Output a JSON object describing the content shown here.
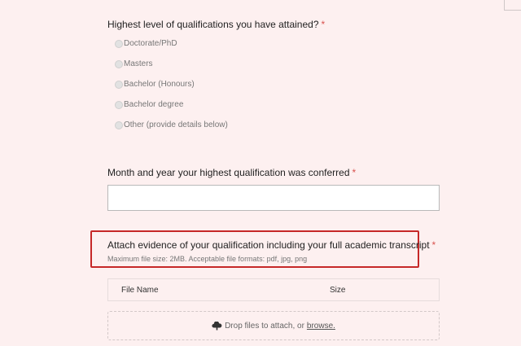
{
  "question_qualification": {
    "label": "Highest level of qualifications you have attained?",
    "required_mark": "*",
    "options": [
      "Doctorate/PhD",
      "Masters",
      "Bachelor (Honours)",
      "Bachelor degree",
      "Other (provide details below)"
    ]
  },
  "question_conferred": {
    "label": "Month and year your highest qualification was conferred",
    "required_mark": "*",
    "value": ""
  },
  "question_attach": {
    "label": "Attach evidence of your qualification including your full academic transcript",
    "required_mark": "*",
    "hint": "Maximum file size: 2MB. Acceptable file formats: pdf, jpg, png",
    "table_headers": {
      "name": "File Name",
      "size": "Size"
    },
    "drop_text": "Drop files to attach, or",
    "browse_text": "browse."
  },
  "colors": {
    "background": "#fdf0f0",
    "required": "#d9534f",
    "highlight_border": "#c62828"
  },
  "icons": {
    "upload": "cloud-upload-icon"
  }
}
